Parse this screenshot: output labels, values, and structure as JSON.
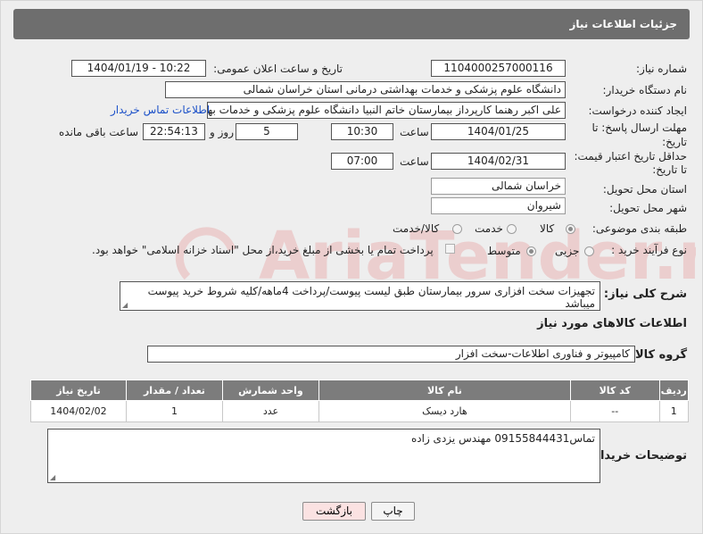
{
  "header": {
    "title": "جزئیات اطلاعات نیاز"
  },
  "fields": {
    "need_number_label": "شماره نیاز:",
    "need_number": "1104000257000116",
    "announce_label": "تاریخ و ساعت اعلان عمومی:",
    "announce_value": "1404/01/19 - 10:22",
    "buyer_org_label": "نام دستگاه خریدار:",
    "buyer_org": "دانشگاه علوم پزشکی و خدمات بهداشتی درمانی استان خراسان شمالی",
    "creator_label": "ایجاد کننده درخواست:",
    "creator": "علی اکبر رهنما کارپرداز بیمارستان خاتم النبیا دانشگاه علوم پزشکی و خدمات بهداشتی",
    "contact_link": "اطلاعات تماس خریدار",
    "deadline_label_1": "مهلت ارسال پاسخ: تا",
    "deadline_label_2": "تاریخ:",
    "deadline_date": "1404/01/25",
    "time_label": "ساعت",
    "deadline_time": "10:30",
    "days_value": "5",
    "days_label": "روز و",
    "remaining_value": "22:54:13",
    "remaining_label": "ساعت باقی مانده",
    "price_label_1": "حداقل تاریخ اعتبار قیمت:",
    "price_label_2": "تا تاریخ:",
    "price_date": "1404/02/31",
    "price_time": "07:00",
    "province_label": "استان محل تحویل:",
    "province": "خراسان شمالی",
    "city_label": "شهر محل تحویل:",
    "city": "شیروان",
    "category_label": "طبقه بندی موضوعی:",
    "category_options": [
      "کالا",
      "خدمت",
      "کالا/خدمت"
    ],
    "category_selected": "کالا",
    "process_label": "نوع فرآیند خرید :",
    "process_options": [
      "جزیی",
      "متوسط"
    ],
    "process_selected": "متوسط",
    "payment_note": "پرداخت تمام یا بخشی از مبلغ خرید،از محل \"اسناد خزانه اسلامی\" خواهد بود."
  },
  "description": {
    "label": "شرح کلی نیاز:",
    "value": "تجهیزات سخت افزاری سرور بیمارستان طبق لیست پیوست/پرداخت 4ماهه/کلیه شروط خرید پیوست میباشد"
  },
  "items_section": {
    "title": "اطلاعات کالاهای مورد نیاز",
    "group_label": "گروه کالا:",
    "group_value": "کامپیوتر و فناوری اطلاعات-سخت افزار",
    "columns": [
      "ردیف",
      "کد کالا",
      "نام کالا",
      "واحد شمارش",
      "تعداد / مقدار",
      "تاریخ نیاز"
    ],
    "rows": [
      [
        "1",
        "--",
        "هارد دیسک",
        "عدد",
        "1",
        "1404/02/02"
      ]
    ]
  },
  "notes": {
    "label": "توضیحات خریدار:",
    "value": "تماس09155844431 مهندس یزدی زاده"
  },
  "buttons": {
    "print": "چاپ",
    "back": "بازگشت"
  },
  "watermark": {
    "text": "AriaTender.neT",
    "color": "#e6a7a7"
  }
}
